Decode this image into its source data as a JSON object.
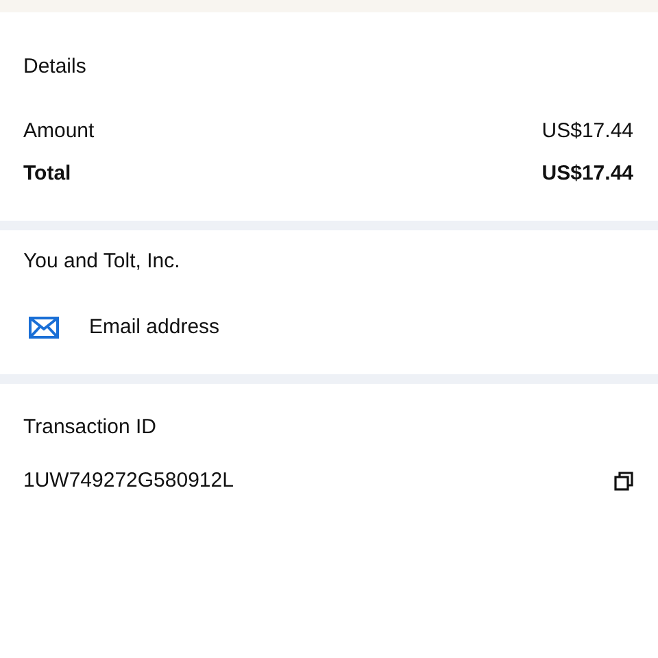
{
  "details": {
    "title": "Details",
    "rows": [
      {
        "kind": "normal",
        "label": "Amount",
        "value": "US$17.44"
      },
      {
        "kind": "total",
        "label": "Total",
        "value": "US$17.44"
      }
    ]
  },
  "party": {
    "title": "You and Tolt, Inc.",
    "contact": "Email address"
  },
  "transaction": {
    "title": "Transaction ID",
    "id": "1UW749272G580912L"
  }
}
